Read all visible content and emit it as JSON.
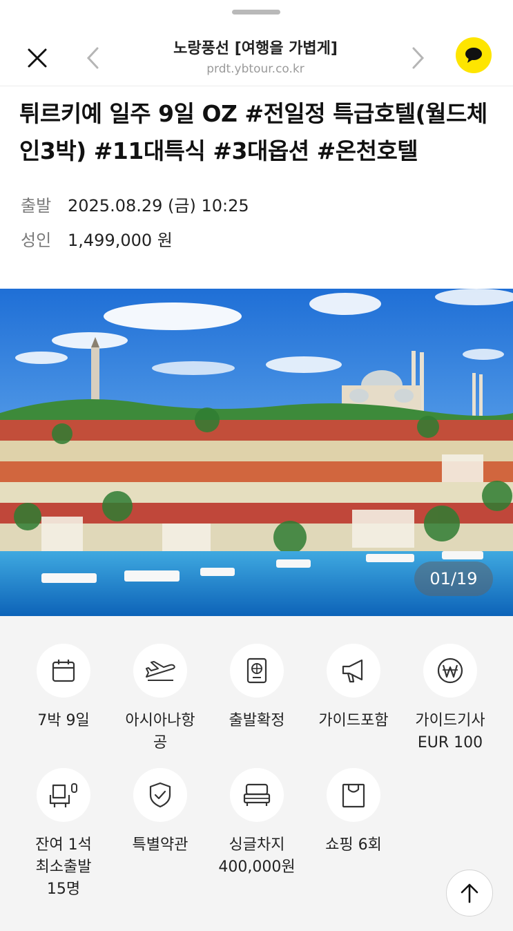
{
  "header": {
    "title": "노랑풍선 [여행을 가볍게]",
    "url": "prdt.ybtour.co.kr"
  },
  "product": {
    "title": "튀르키예 일주 9일 OZ #전일정 특급호텔(월드체인3박) #11대특식 #3대옵션 #온천호텔",
    "departure_label": "출발",
    "departure_value": "2025.08.29 (금) 10:25",
    "price_label": "성인",
    "price_value": "1,499,000 원"
  },
  "gallery": {
    "counter": "01/19"
  },
  "features": [
    {
      "icon": "calendar-icon",
      "label": "7박 9일"
    },
    {
      "icon": "airplane-icon",
      "label": "아시아나항\n공"
    },
    {
      "icon": "passport-icon",
      "label": "출발확정"
    },
    {
      "icon": "megaphone-icon",
      "label": "가이드포함"
    },
    {
      "icon": "won-icon",
      "label": "가이드기사\nEUR 100"
    },
    {
      "icon": "seat-icon",
      "label": "잔여 1석\n최소출발\n15명"
    },
    {
      "icon": "shield-check-icon",
      "label": "특별약관"
    },
    {
      "icon": "bed-icon",
      "label": "싱글차지\n400,000원"
    },
    {
      "icon": "shopping-bag-icon",
      "label": "쇼핑 6회"
    }
  ],
  "colors": {
    "kakao_yellow": "#fee500",
    "feature_bg": "#f4f4f4"
  }
}
